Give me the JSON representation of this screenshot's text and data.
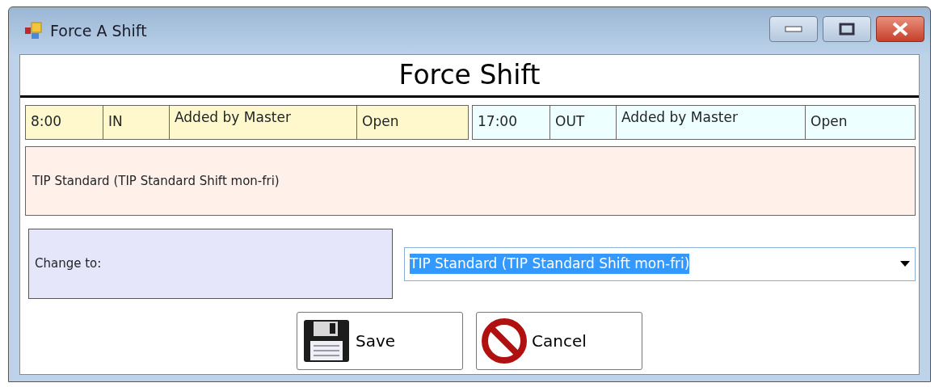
{
  "window": {
    "title": "Force A Shift"
  },
  "header": "Force Shift",
  "punches": [
    {
      "time": "8:00",
      "direction": "IN",
      "note": "Added by Master",
      "status": "Open",
      "color": "#fff8cc"
    },
    {
      "time": "17:00",
      "direction": "OUT",
      "note": "Added by Master",
      "status": "Open",
      "color": "#eeffff"
    }
  ],
  "current_shift": "TIP Standard (TIP Standard Shift mon-fri)",
  "change_to": {
    "label": "Change to:",
    "value": "TIP Standard (TIP Standard Shift mon-fri)"
  },
  "buttons": [
    {
      "kind": "save",
      "label": "Save"
    },
    {
      "kind": "cancel",
      "label": "Cancel"
    }
  ]
}
